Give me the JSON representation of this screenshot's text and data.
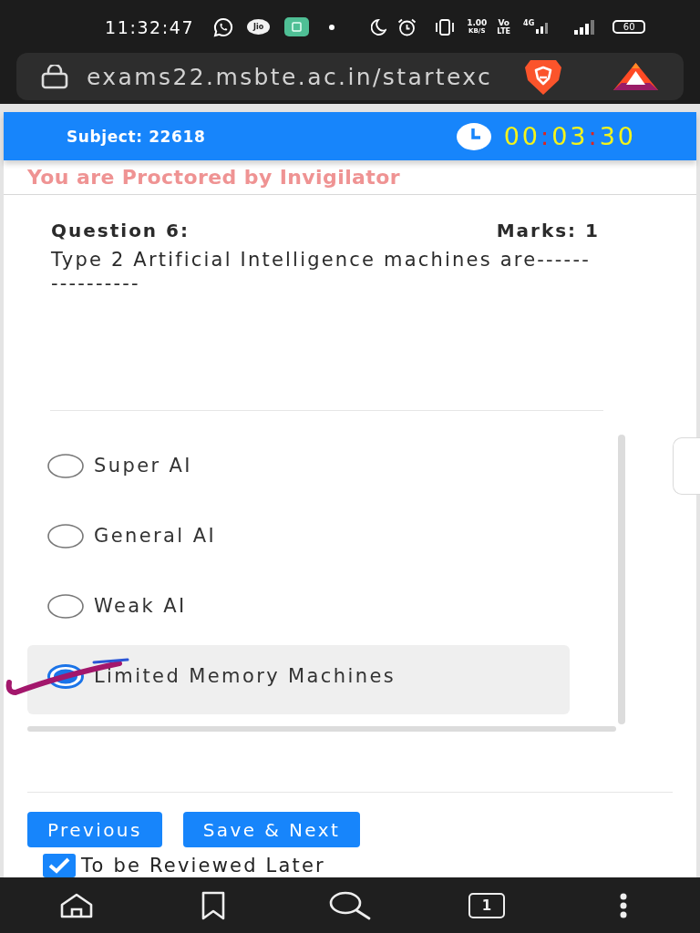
{
  "status_bar": {
    "time": "11:32:47",
    "carrier_badge": "Jio",
    "network_speed": [
      "1.00",
      "KB/S"
    ],
    "volte": [
      "Vo",
      "LTE"
    ],
    "data_network": "4G",
    "battery": "60"
  },
  "address_bar": {
    "url": "exams22.msbte.ac.in/startexc"
  },
  "exam_header": {
    "subject": "Subject: 22618",
    "timer": "00:03:30"
  },
  "proctor_notice": "You are Proctored by Invigilator",
  "question": {
    "number": "Question 6:",
    "marks": "Marks: 1",
    "text": "Type 2 Artificial Intelligence machines are----------------"
  },
  "options": [
    {
      "label": "Super AI",
      "selected": false
    },
    {
      "label": "General AI",
      "selected": false
    },
    {
      "label": "Weak AI",
      "selected": false
    },
    {
      "label": "Limited Memory Machines",
      "selected": true
    }
  ],
  "buttons": [
    "Previous",
    "Save & Next"
  ],
  "review_later": {
    "label": "To be Reviewed Later",
    "checked": true
  },
  "bottom_nav": {
    "tab_count": "1"
  }
}
